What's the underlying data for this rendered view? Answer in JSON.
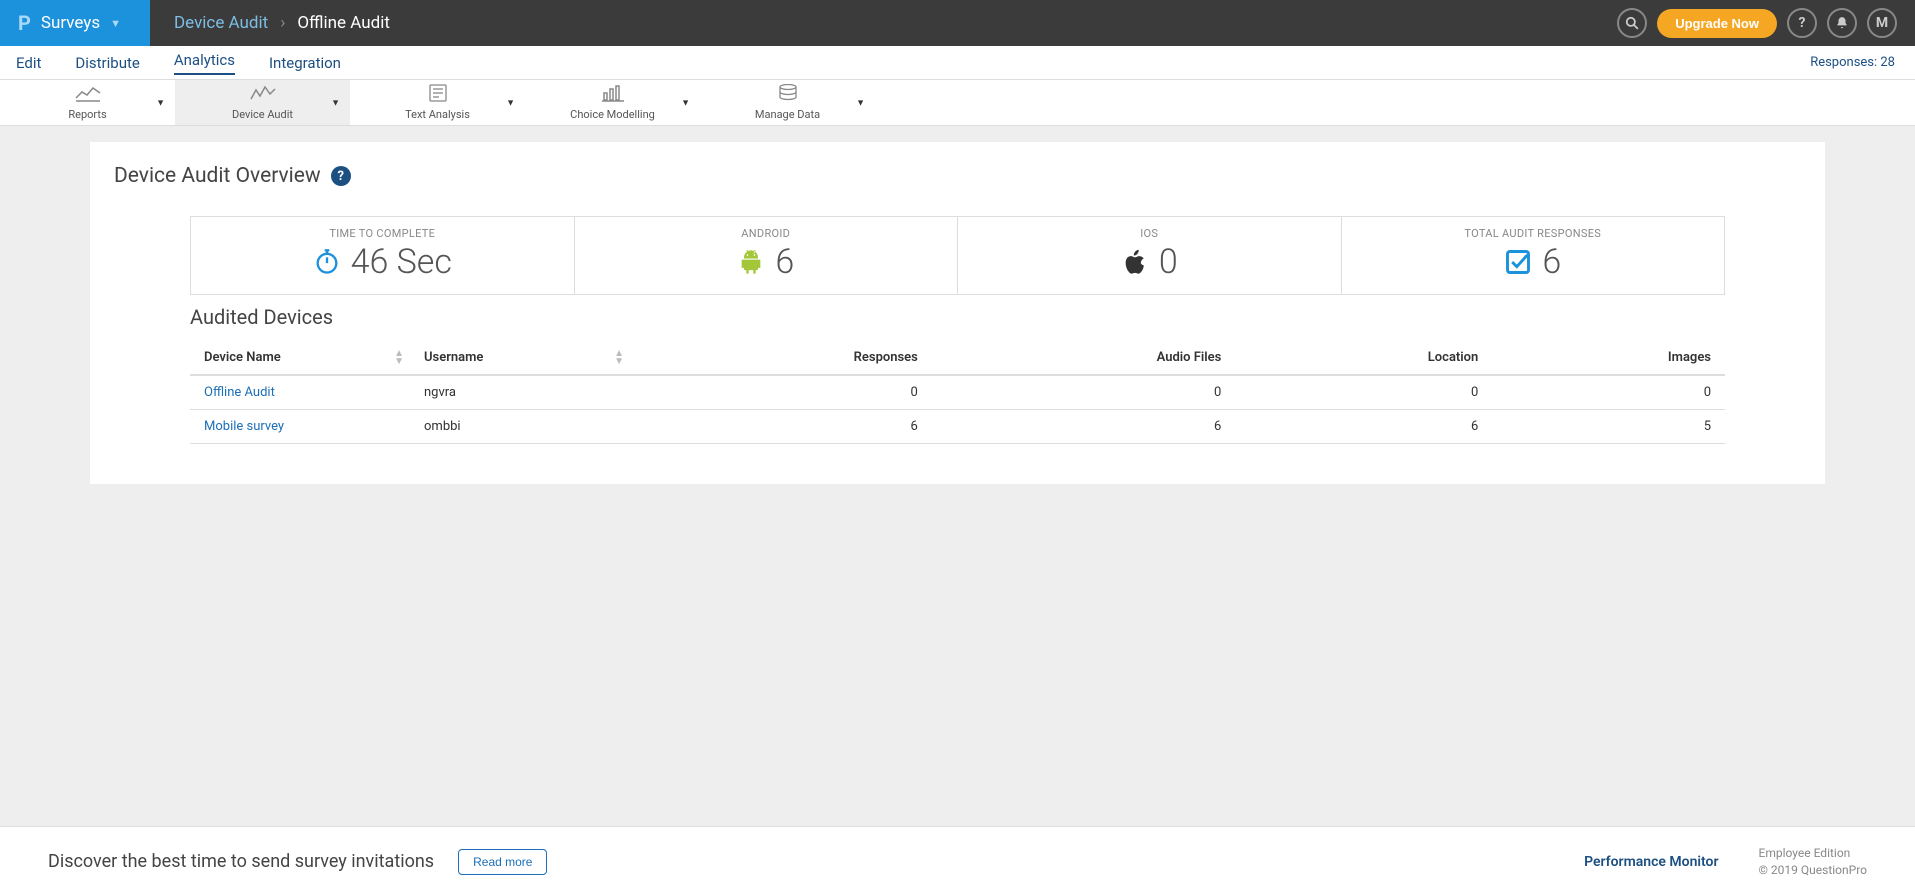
{
  "topbar": {
    "module_label": "Surveys",
    "breadcrumb_link": "Device Audit",
    "breadcrumb_current": "Offline Audit",
    "upgrade_label": "Upgrade Now",
    "user_initial": "M"
  },
  "main_nav": {
    "items": [
      "Edit",
      "Distribute",
      "Analytics",
      "Integration"
    ],
    "active_index": 2,
    "responses_label": "Responses: 28"
  },
  "sub_nav": {
    "items": [
      "Reports",
      "Device Audit",
      "Text Analysis",
      "Choice Modelling",
      "Manage Data"
    ],
    "active_index": 1
  },
  "page": {
    "title": "Device Audit Overview",
    "section_title": "Audited Devices"
  },
  "stats": {
    "time_label": "TIME TO COMPLETE",
    "time_value": "46 Sec",
    "android_label": "ANDROID",
    "android_value": "6",
    "ios_label": "IOS",
    "ios_value": "0",
    "total_label": "TOTAL AUDIT RESPONSES",
    "total_value": "6"
  },
  "table": {
    "headers": {
      "device": "Device Name",
      "username": "Username",
      "responses": "Responses",
      "audio": "Audio Files",
      "location": "Location",
      "images": "Images"
    },
    "rows": [
      {
        "device": "Offline Audit",
        "username": "ngvra",
        "responses": "0",
        "audio": "0",
        "location": "0",
        "images": "0"
      },
      {
        "device": "Mobile survey",
        "username": "ombbi",
        "responses": "6",
        "audio": "6",
        "location": "6",
        "images": "5"
      }
    ]
  },
  "footer": {
    "message": "Discover the best time to send survey invitations",
    "read_more": "Read more",
    "perf_monitor": "Performance Monitor",
    "edition": "Employee Edition",
    "copyright": "© 2019 QuestionPro"
  }
}
